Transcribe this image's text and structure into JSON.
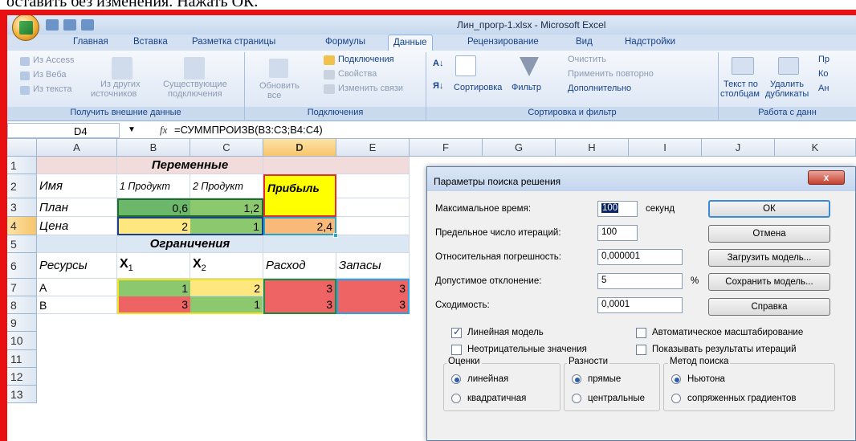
{
  "caption": "оставить без изменения. Нажать ОК.",
  "window_title": "Лин_прогр-1.xlsx - Microsoft Excel",
  "tabs": [
    "Главная",
    "Вставка",
    "Разметка страницы",
    "Формулы",
    "Данные",
    "Рецензирование",
    "Вид",
    "Надстройки"
  ],
  "active_tab": "Данные",
  "ribbon": {
    "ext": {
      "access": "Из Access",
      "web": "Из Веба",
      "text": "Из текста",
      "other1": "Из других",
      "other2": "источников",
      "exist1": "Существующие",
      "exist2": "подключения",
      "label": "Получить внешние данные"
    },
    "conn": {
      "refresh1": "Обновить",
      "refresh2": "все",
      "connections": "Подключения",
      "properties": "Свойства",
      "edit_links": "Изменить связи",
      "label": "Подключения"
    },
    "sort": {
      "sort": "Сортировка",
      "filter": "Фильтр",
      "clear": "Очистить",
      "reapply": "Применить повторно",
      "advanced": "Дополнительно",
      "label": "Сортировка и фильтр"
    },
    "tools": {
      "t2c1": "Текст по",
      "t2c2": "столбцам",
      "dup1": "Удалить",
      "dup2": "дубликаты",
      "label": "Работа с данн",
      "p": "Пр",
      "k": "Ко",
      "a": "Ан"
    }
  },
  "namebox": "D4",
  "fx": "fx",
  "formula": "=СУММПРОИЗВ(B3:C3;B4:C4)",
  "columns": [
    "A",
    "B",
    "C",
    "D",
    "E",
    "F",
    "G",
    "H",
    "I",
    "J",
    "K"
  ],
  "rows": [
    "1",
    "2",
    "3",
    "4",
    "5",
    "6",
    "7",
    "8",
    "9",
    "10",
    "11",
    "12",
    "13"
  ],
  "cells": {
    "B1": "Переменные",
    "A2": "Имя",
    "B2": "1 Продукт",
    "C2": "2 Продукт",
    "D2": "Прибыль",
    "A3": "План",
    "B3": "0,6",
    "C3": "1,2",
    "A4": "Цена",
    "B4": "2",
    "C4": "1",
    "D4": "2,4",
    "B5": "Ограничения",
    "A6": "Ресурсы",
    "B6": "X",
    "B6s": "1",
    "C6": "X",
    "C6s": "2",
    "D6": "Расход",
    "E6": "Запасы",
    "A7": "A",
    "B7": "1",
    "C7": "2",
    "D7": "3",
    "E7": "3",
    "A8": "B",
    "B8": "3",
    "C8": "1",
    "D8": "3",
    "E8": "3"
  },
  "colors": {
    "green": "#7cbf6a",
    "yellow": "#ffff00",
    "lightyellow": "#fee77f",
    "orange": "#f9b979",
    "red": "#ee6363",
    "pink": "#f2dcdb",
    "blue": "#dbe7f2"
  },
  "dialog": {
    "title": "Параметры поиска решения",
    "close": "x",
    "max_time_label": "Максимальное время:",
    "max_time": "100",
    "seconds": "секунд",
    "iter_label": "Предельное число итераций:",
    "iter": "100",
    "precision_label": "Относительная погрешность:",
    "precision": "0,000001",
    "tolerance_label": "Допустимое отклонение:",
    "tolerance": "5",
    "percent": "%",
    "convergence_label": "Сходимость:",
    "convergence": "0,0001",
    "ok": "ОК",
    "cancel": "Отмена",
    "load": "Загрузить модель...",
    "save": "Сохранить модель...",
    "help": "Справка",
    "linear": "Линейная модель",
    "nonneg": "Неотрицательные значения",
    "autoscale": "Автоматическое масштабирование",
    "show_iter": "Показывать результаты итераций",
    "estimates": "Оценки",
    "est_linear": "линейная",
    "est_quad": "квадратичная",
    "derivatives": "Разности",
    "der_forward": "прямые",
    "der_central": "центральные",
    "search": "Метод поиска",
    "s_newton": "Ньютона",
    "s_conj": "сопряженных градиентов"
  }
}
